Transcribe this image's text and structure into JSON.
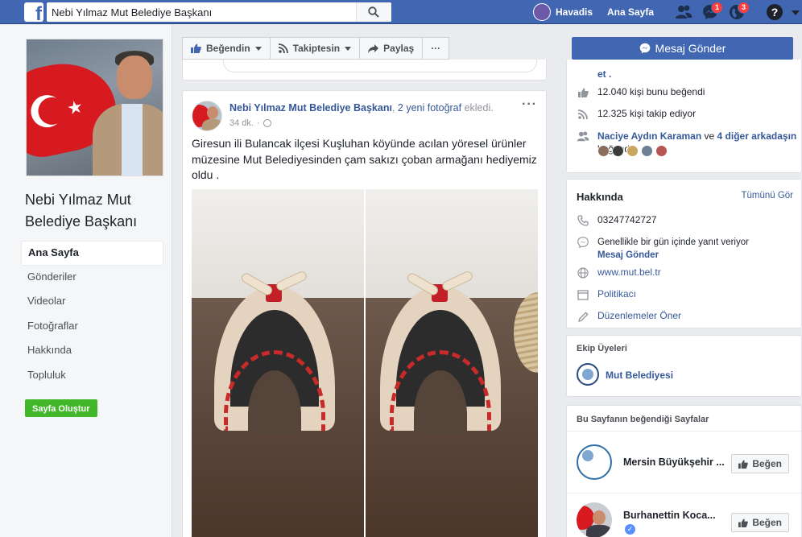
{
  "topbar": {
    "search_value": "Nebi Yılmaz Mut Belediye Başkanı",
    "user_link": "Havadis",
    "home_link": "Ana Sayfa",
    "messages_badge": "1",
    "notifications_badge": "3"
  },
  "sidebar": {
    "page_name": "Nebi Yılmaz Mut Belediye Başkanı",
    "items": [
      {
        "label": "Ana Sayfa"
      },
      {
        "label": "Gönderiler"
      },
      {
        "label": "Videolar"
      },
      {
        "label": "Fotoğraflar"
      },
      {
        "label": "Hakkında"
      },
      {
        "label": "Topluluk"
      }
    ],
    "create_page_label": "Sayfa Oluştur"
  },
  "actions": {
    "like_label": "Beğendin",
    "follow_label": "Takiptesin",
    "share_label": "Paylaş",
    "more_label": "···",
    "send_message_label": "Mesaj Gönder"
  },
  "post": {
    "author": "Nebi Yılmaz Mut Belediye Başkanı",
    "action_count": "2 yeni fotoğraf",
    "action_verb": " ekledi.",
    "time": "34 dk.",
    "separator": "·",
    "more": "···",
    "text": "Giresun ili Bulancak ilçesi Kuşluhan köyünde acılan yöresel ürünler müzesine Mut Belediyesinden çam sakızı çoban armağanı hediyemiz oldu ."
  },
  "community": {
    "truncated_link": "et .",
    "likes_text": "12.040 kişi bunu beğendi",
    "follows_text": "12.325 kişi takip ediyor",
    "friends_names": "Naciye Aydın Karaman",
    "friends_connector": " ve ",
    "friends_others": "4 diğer arkadaşın",
    "friends_suffix": "beğendi",
    "friend_colors": [
      "#8a6d5a",
      "#3b3b3b",
      "#c9a560",
      "#6d7f94",
      "#b75555"
    ]
  },
  "about": {
    "title": "Hakkında",
    "see_all": "Tümünü Gör",
    "phone": "03247742727",
    "response_text": "Genellikle bir gün içinde yanıt veriyor",
    "send_message": "Mesaj Gönder",
    "website": "www.mut.bel.tr",
    "category": "Politikacı",
    "suggest_edits": "Düzenlemeler Öner"
  },
  "team": {
    "title": "Ekip Üyeleri",
    "member": "Mut Belediyesi"
  },
  "liked_pages": {
    "title": "Bu Sayfanın beğendiği Sayfalar",
    "pages": [
      {
        "name": "Mersin Büyükşehir ...",
        "button": "Beğen"
      },
      {
        "name": "Burhanettin Koca...",
        "button": "Beğen"
      }
    ]
  },
  "colors": {
    "brand_blue": "#4267b2",
    "link_blue": "#365899",
    "create_green": "#42b72a",
    "badge_red": "#fa3e3e"
  }
}
